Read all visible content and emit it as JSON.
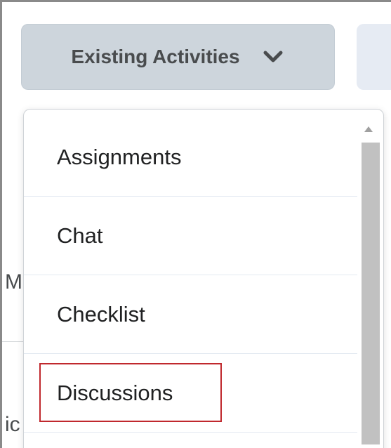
{
  "toolbar": {
    "existing_activities_label": "Existing Activities",
    "existing_activities_icon": "chevron-down-icon"
  },
  "background": {
    "partial_left_text_1": "M",
    "partial_left_text_2": "ic"
  },
  "dropdown": {
    "items": [
      {
        "label": "Assignments",
        "highlighted": false
      },
      {
        "label": "Chat",
        "highlighted": false
      },
      {
        "label": "Checklist",
        "highlighted": false
      },
      {
        "label": "Discussions",
        "highlighted": true
      }
    ]
  },
  "colors": {
    "button_bg": "#cdd5dc",
    "highlight_border": "#c0282d",
    "text": "#202122"
  }
}
